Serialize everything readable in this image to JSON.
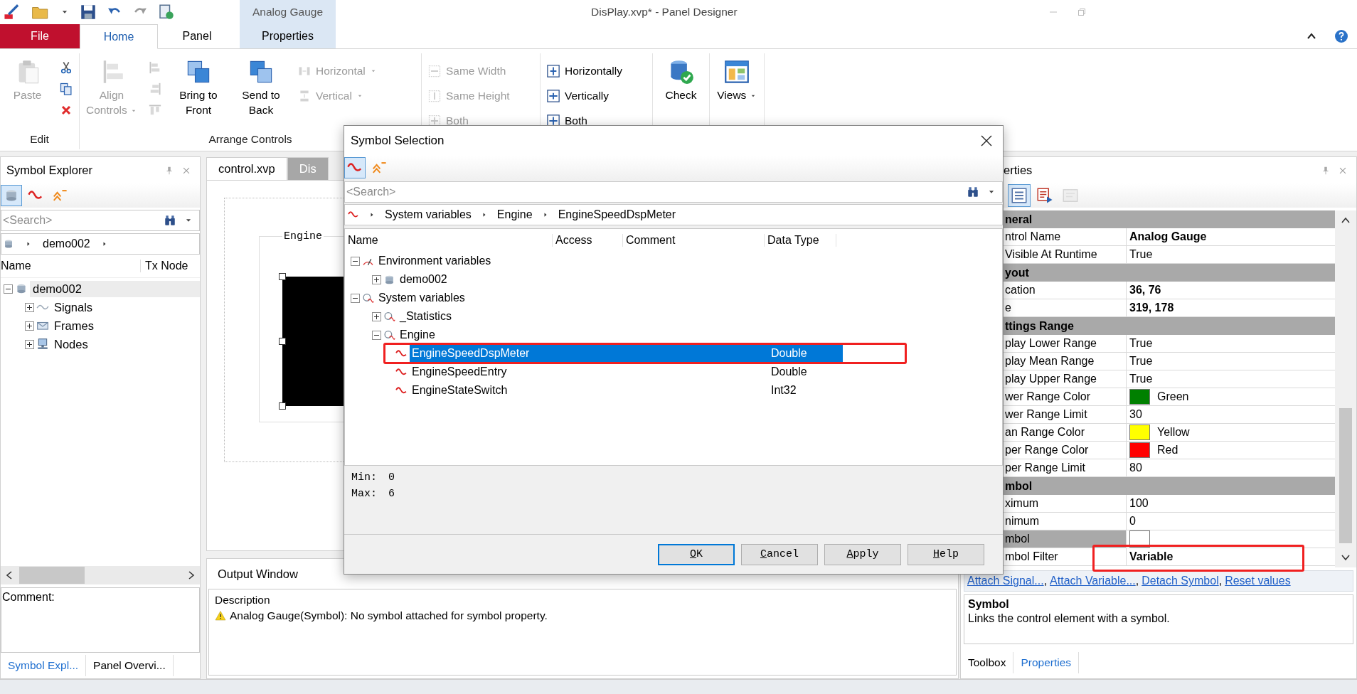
{
  "window": {
    "title": "DisPlay.xvp* - Panel Designer",
    "context_group": "Analog Gauge"
  },
  "ribbon_tabs": [
    {
      "label": "File",
      "kind": "file",
      "selected": false
    },
    {
      "label": "Home",
      "kind": "normal",
      "selected": true
    },
    {
      "label": "Panel",
      "kind": "normal",
      "selected": false
    },
    {
      "label": "Properties",
      "kind": "contextual",
      "selected": false
    }
  ],
  "ribbon": [
    {
      "label": "Edit",
      "items": [
        {
          "kind": "large",
          "label": "Paste",
          "disabled": true,
          "dropdown": false
        },
        {
          "kind": "icons",
          "buttons": [
            {
              "disabled": false
            },
            {
              "disabled": false
            },
            {
              "disabled": false
            }
          ]
        }
      ]
    },
    {
      "label": "Arrange Controls",
      "items": [
        {
          "kind": "large",
          "label": "Align Controls",
          "disabled": true,
          "dropdown": true
        },
        {
          "kind": "icons",
          "buttons": [
            {
              "disabled": true
            },
            {
              "disabled": true
            },
            {
              "disabled": true
            }
          ]
        },
        {
          "kind": "large",
          "label": "Bring to Front",
          "disabled": false,
          "dropdown": false
        },
        {
          "kind": "large",
          "label": "Send to Back",
          "disabled": false,
          "dropdown": false
        },
        {
          "kind": "small",
          "buttons": [
            {
              "label": "Horizontal",
              "disabled": true,
              "dropdown": true
            },
            {
              "label": "Vertical",
              "disabled": true,
              "dropdown": true
            }
          ]
        }
      ]
    },
    {
      "items": [
        {
          "kind": "small",
          "buttons": [
            {
              "label": "Same Width",
              "disabled": true,
              "dropdown": false
            },
            {
              "label": "Same Height",
              "disabled": true,
              "dropdown": false
            },
            {
              "label": "Both",
              "disabled": true,
              "dropdown": false
            }
          ]
        }
      ]
    },
    {
      "items": [
        {
          "kind": "small",
          "buttons": [
            {
              "label": "Horizontally",
              "disabled": false,
              "dropdown": false
            },
            {
              "label": "Vertically",
              "disabled": false,
              "dropdown": false
            },
            {
              "label": "Both",
              "disabled": false,
              "dropdown": false
            }
          ]
        }
      ]
    },
    {
      "items": [
        {
          "kind": "large",
          "label": "Check",
          "disabled": false,
          "dropdown": false
        }
      ]
    },
    {
      "items": [
        {
          "kind": "large",
          "label": "Views",
          "disabled": false,
          "dropdown": true
        }
      ]
    }
  ],
  "symbol_explorer": {
    "title": "Symbol Explorer",
    "toolbar": [
      {
        "selected": true
      },
      {
        "selected": false
      },
      {
        "selected": false
      }
    ],
    "search": {
      "placeholder": "<Search>"
    },
    "breadcrumb": [
      "demo002"
    ],
    "columns": [
      "Name",
      "Tx Node"
    ],
    "tree": [
      {
        "label": "demo002",
        "kind": "database",
        "expanded": true,
        "selected": true,
        "children": [
          {
            "label": "Signals",
            "kind": "signals",
            "expanded": false,
            "selected": false
          },
          {
            "label": "Frames",
            "kind": "frames",
            "expanded": false,
            "selected": false
          },
          {
            "label": "Nodes",
            "kind": "nodes",
            "expanded": false,
            "selected": false
          }
        ]
      }
    ],
    "comment_label": "Comment:",
    "tabs": [
      {
        "label": "Symbol Expl...",
        "selected": true
      },
      {
        "label": "Panel Overvi...",
        "selected": false
      }
    ]
  },
  "document_tabs": [
    {
      "label": "control.xvp",
      "selected": false
    },
    {
      "label": "Dis",
      "selected": true
    }
  ],
  "canvas": {
    "group_label": "Engine"
  },
  "output_window": {
    "title": "Output Window",
    "column": "Description",
    "messages": [
      {
        "kind": "warning",
        "text": "Analog Gauge(Symbol): No symbol attached for symbol property."
      }
    ]
  },
  "properties": {
    "title": "erties",
    "toolbar": [
      {
        "selected": true,
        "disabled": false
      },
      {
        "selected": false,
        "disabled": false
      },
      {
        "selected": false,
        "disabled": true
      }
    ],
    "rows": [
      {
        "kind": "category",
        "label": "neral"
      },
      {
        "kind": "property",
        "label": "ntrol Name",
        "value": "Analog Gauge",
        "bold": true,
        "selected": false
      },
      {
        "kind": "property",
        "label": "Visible At Runtime",
        "value": "True",
        "bold": false,
        "selected": false
      },
      {
        "kind": "category",
        "label": "yout"
      },
      {
        "kind": "property",
        "label": "cation",
        "value": "36, 76",
        "bold": true,
        "selected": false
      },
      {
        "kind": "property",
        "label": "e",
        "value": "319, 178",
        "bold": true,
        "selected": false
      },
      {
        "kind": "category",
        "label": "ttings Range"
      },
      {
        "kind": "property",
        "label": "play Lower Range",
        "value": "True",
        "bold": false,
        "selected": false
      },
      {
        "kind": "property",
        "label": "play Mean Range",
        "value": "True",
        "bold": false,
        "selected": false
      },
      {
        "kind": "property",
        "label": "play Upper Range",
        "value": "True",
        "bold": false,
        "selected": false
      },
      {
        "kind": "color",
        "label": "wer Range Color",
        "value": "Green",
        "color": "#008000",
        "selected": false
      },
      {
        "kind": "property",
        "label": "wer Range Limit",
        "value": "30",
        "bold": false,
        "selected": false
      },
      {
        "kind": "color",
        "label": "an Range Color",
        "value": "Yellow",
        "color": "#ffff00",
        "selected": false
      },
      {
        "kind": "color",
        "label": "per Range Color",
        "value": "Red",
        "color": "#ff0000",
        "selected": false
      },
      {
        "kind": "property",
        "label": "per Range Limit",
        "value": "80",
        "bold": false,
        "selected": false
      },
      {
        "kind": "category",
        "label": "mbol"
      },
      {
        "kind": "property",
        "label": "ximum",
        "value": "100",
        "bold": false,
        "selected": false
      },
      {
        "kind": "property",
        "label": "nimum",
        "value": "0",
        "bold": false,
        "selected": false
      },
      {
        "kind": "field",
        "label": "mbol",
        "selected": true
      },
      {
        "kind": "property",
        "label": "mbol Filter",
        "value": "Variable",
        "bold": true,
        "selected": false
      }
    ],
    "links": [
      {
        "label": "Attach Signal...",
        "separator": ","
      },
      {
        "label": "Attach Variable...",
        "separator": ","
      },
      {
        "label": "Detach Symbol",
        "separator": ","
      },
      {
        "label": "Reset values"
      }
    ],
    "help": {
      "title": "Symbol",
      "text": "Links the control element with a symbol."
    },
    "tabs": [
      {
        "label": "Toolbox",
        "selected": false
      },
      {
        "label": "Properties",
        "selected": true
      }
    ]
  },
  "dialog": {
    "title": "Symbol Selection",
    "toolbar": [
      {
        "selected": true
      },
      {
        "selected": false
      }
    ],
    "search": {
      "placeholder": "<Search>"
    },
    "breadcrumb": [
      "System variables",
      "Engine",
      "EngineSpeedDspMeter"
    ],
    "columns": [
      "Name",
      "Access",
      "Comment",
      "Data Type"
    ],
    "tree": [
      {
        "label": "Environment variables",
        "kind": "environment",
        "expanded": true,
        "selected": false,
        "children": [
          {
            "label": "demo002",
            "kind": "database",
            "expanded": false,
            "selected": false
          }
        ]
      },
      {
        "label": "System variables",
        "kind": "system",
        "expanded": true,
        "selected": false,
        "children": [
          {
            "label": "_Statistics",
            "kind": "system",
            "expanded": false,
            "selected": false
          },
          {
            "label": "Engine",
            "kind": "system",
            "expanded": true,
            "selected": false,
            "children": [
              {
                "label": "EngineSpeedDspMeter",
                "kind": "variable",
                "data_type": "Double",
                "selected": true
              },
              {
                "label": "EngineSpeedEntry",
                "kind": "variable",
                "data_type": "Double",
                "selected": false
              },
              {
                "label": "EngineStateSwitch",
                "kind": "variable",
                "data_type": "Int32",
                "selected": false
              }
            ]
          }
        ]
      }
    ],
    "info": [
      {
        "label": "Min:",
        "value": "0"
      },
      {
        "label": "Max:",
        "value": "6"
      }
    ],
    "buttons": [
      {
        "label": "OK",
        "default": true
      },
      {
        "label": "Cancel",
        "default": false
      },
      {
        "label": "Apply",
        "default": false
      },
      {
        "label": "Help",
        "default": false
      }
    ]
  }
}
